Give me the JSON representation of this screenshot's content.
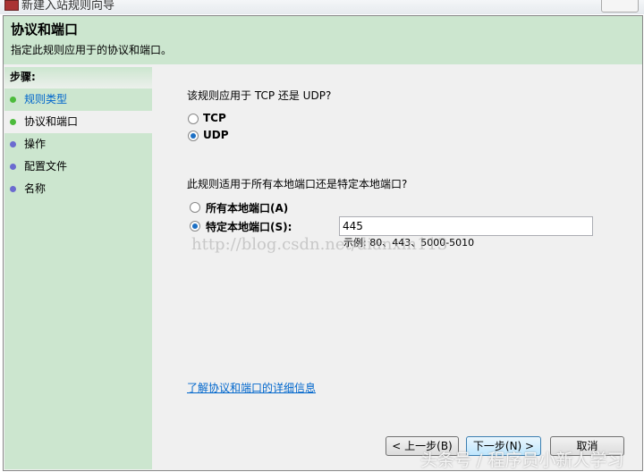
{
  "window": {
    "title": "新建入站规则向导"
  },
  "header": {
    "title": "协议和端口",
    "subtitle": "指定此规则应用于的协议和端口。"
  },
  "steps": {
    "heading": "步骤:",
    "items": [
      {
        "label": "规则类型",
        "state": "done"
      },
      {
        "label": "协议和端口",
        "state": "current"
      },
      {
        "label": "操作",
        "state": "pending"
      },
      {
        "label": "配置文件",
        "state": "pending"
      },
      {
        "label": "名称",
        "state": "pending"
      }
    ]
  },
  "protocol": {
    "question": "该规则应用于 TCP 还是 UDP?",
    "options": [
      {
        "label": "TCP",
        "selected": false
      },
      {
        "label": "UDP",
        "selected": true
      }
    ]
  },
  "ports": {
    "question": "此规则适用于所有本地端口还是特定本地端口?",
    "all_label": "所有本地端口(A)",
    "specific_label": "特定本地端口(S):",
    "value": "445",
    "example": "示例: 80、443、5000-5010"
  },
  "link": "了解协议和端口的详细信息",
  "buttons": {
    "back": "< 上一步(B)",
    "next": "下一步(N) >",
    "cancel": "取消"
  },
  "watermarks": {
    "url": "http://blog.csdn.net/dianxin113",
    "credit": "头条号 / 程序员小新人学习"
  },
  "colors": {
    "header_bg": "#cce6cf",
    "done_dot": "#4cbb3c",
    "pending_dot": "#6b6bd0",
    "link": "#0066cc"
  }
}
